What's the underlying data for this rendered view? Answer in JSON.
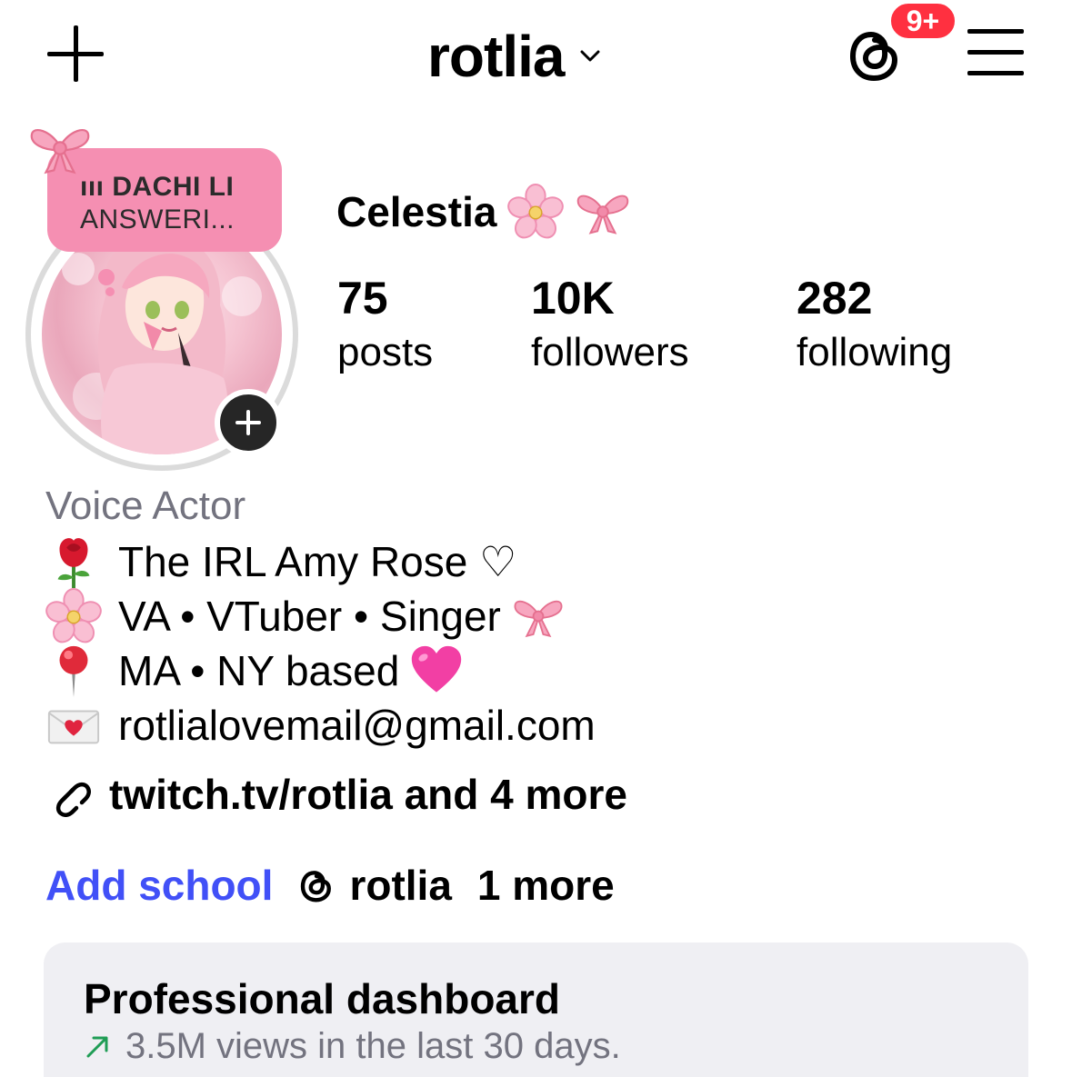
{
  "header": {
    "username": "rotlia",
    "notification_badge": "9+",
    "icons": [
      "plus-icon",
      "chevron-down-icon",
      "threads-icon",
      "menu-icon"
    ]
  },
  "note": {
    "line1": "ııı  DACHI LI",
    "line2": "ANSWERI..."
  },
  "profile": {
    "display_name": "Celestia",
    "stats": [
      {
        "value": "75",
        "label": "posts"
      },
      {
        "value": "10K",
        "label": "followers"
      },
      {
        "value": "282",
        "label": "following"
      }
    ]
  },
  "bio": {
    "category": "Voice Actor",
    "lines": [
      {
        "icon": "rose-icon",
        "text": "The IRL Amy Rose ♡"
      },
      {
        "icon": "cherry-blossom-icon",
        "text": "VA • VTuber • Singer"
      },
      {
        "icon": "pushpin-icon",
        "text": "MA • NY based"
      },
      {
        "icon": "love-letter-icon",
        "text": "rotlialovemail@gmail.com"
      }
    ],
    "link": "twitch.tv/rotlia and 4 more"
  },
  "meta": {
    "add_school": "Add school",
    "threads_name": "rotlia",
    "more": "1 more"
  },
  "dashboard": {
    "title": "Professional dashboard",
    "subtitle": "3.5M views in the last 30 days."
  },
  "colors": {
    "badge": "#ff3040",
    "link_blue": "#4150f7",
    "note_pink": "#f58fb2",
    "muted_text": "#73737f",
    "dashboard_bg": "#efeff3",
    "trend_green": "#1f9d55"
  }
}
